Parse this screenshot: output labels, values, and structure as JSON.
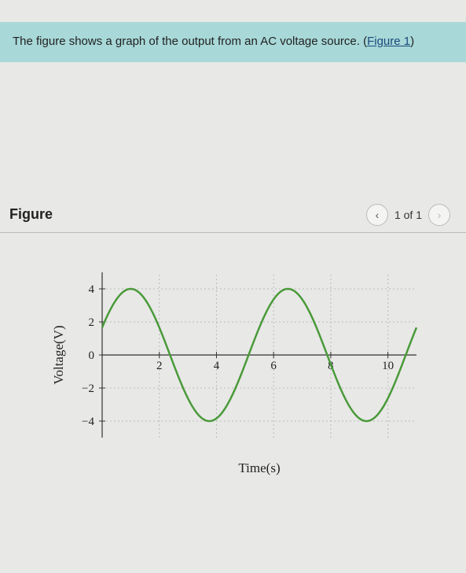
{
  "question": {
    "text_before_link": "The figure shows a graph of the output from an AC voltage source. (",
    "link_text": "Figure 1",
    "text_after_link": ")"
  },
  "figure": {
    "title": "Figure",
    "pager": "1 of 1",
    "prev_glyph": "‹",
    "next_glyph": "›"
  },
  "chart_data": {
    "type": "line",
    "title": "",
    "xlabel": "Time(s)",
    "ylabel": "Voltage(V)",
    "xlim": [
      0,
      11
    ],
    "ylim": [
      -5,
      5
    ],
    "xticks": [
      2,
      4,
      6,
      8,
      10
    ],
    "yticks": [
      -4,
      -2,
      0,
      2,
      4
    ],
    "series": [
      {
        "name": "AC voltage",
        "function": "V(t) = 4*cos(2*pi*(t-1)/5.5)",
        "amplitude": 4,
        "period": 5.5,
        "phase_peak_at": 1.0,
        "sample_points_x": [
          0,
          1,
          2,
          3,
          3.75,
          4.5,
          5.5,
          6.5,
          7.5,
          8.25,
          9.25,
          10,
          11
        ],
        "sample_points_y": [
          1.4,
          4.0,
          1.4,
          -3.0,
          -4.0,
          -3.0,
          1.4,
          4.0,
          1.4,
          -2.0,
          -4.0,
          -2.0,
          2.8
        ]
      }
    ]
  }
}
